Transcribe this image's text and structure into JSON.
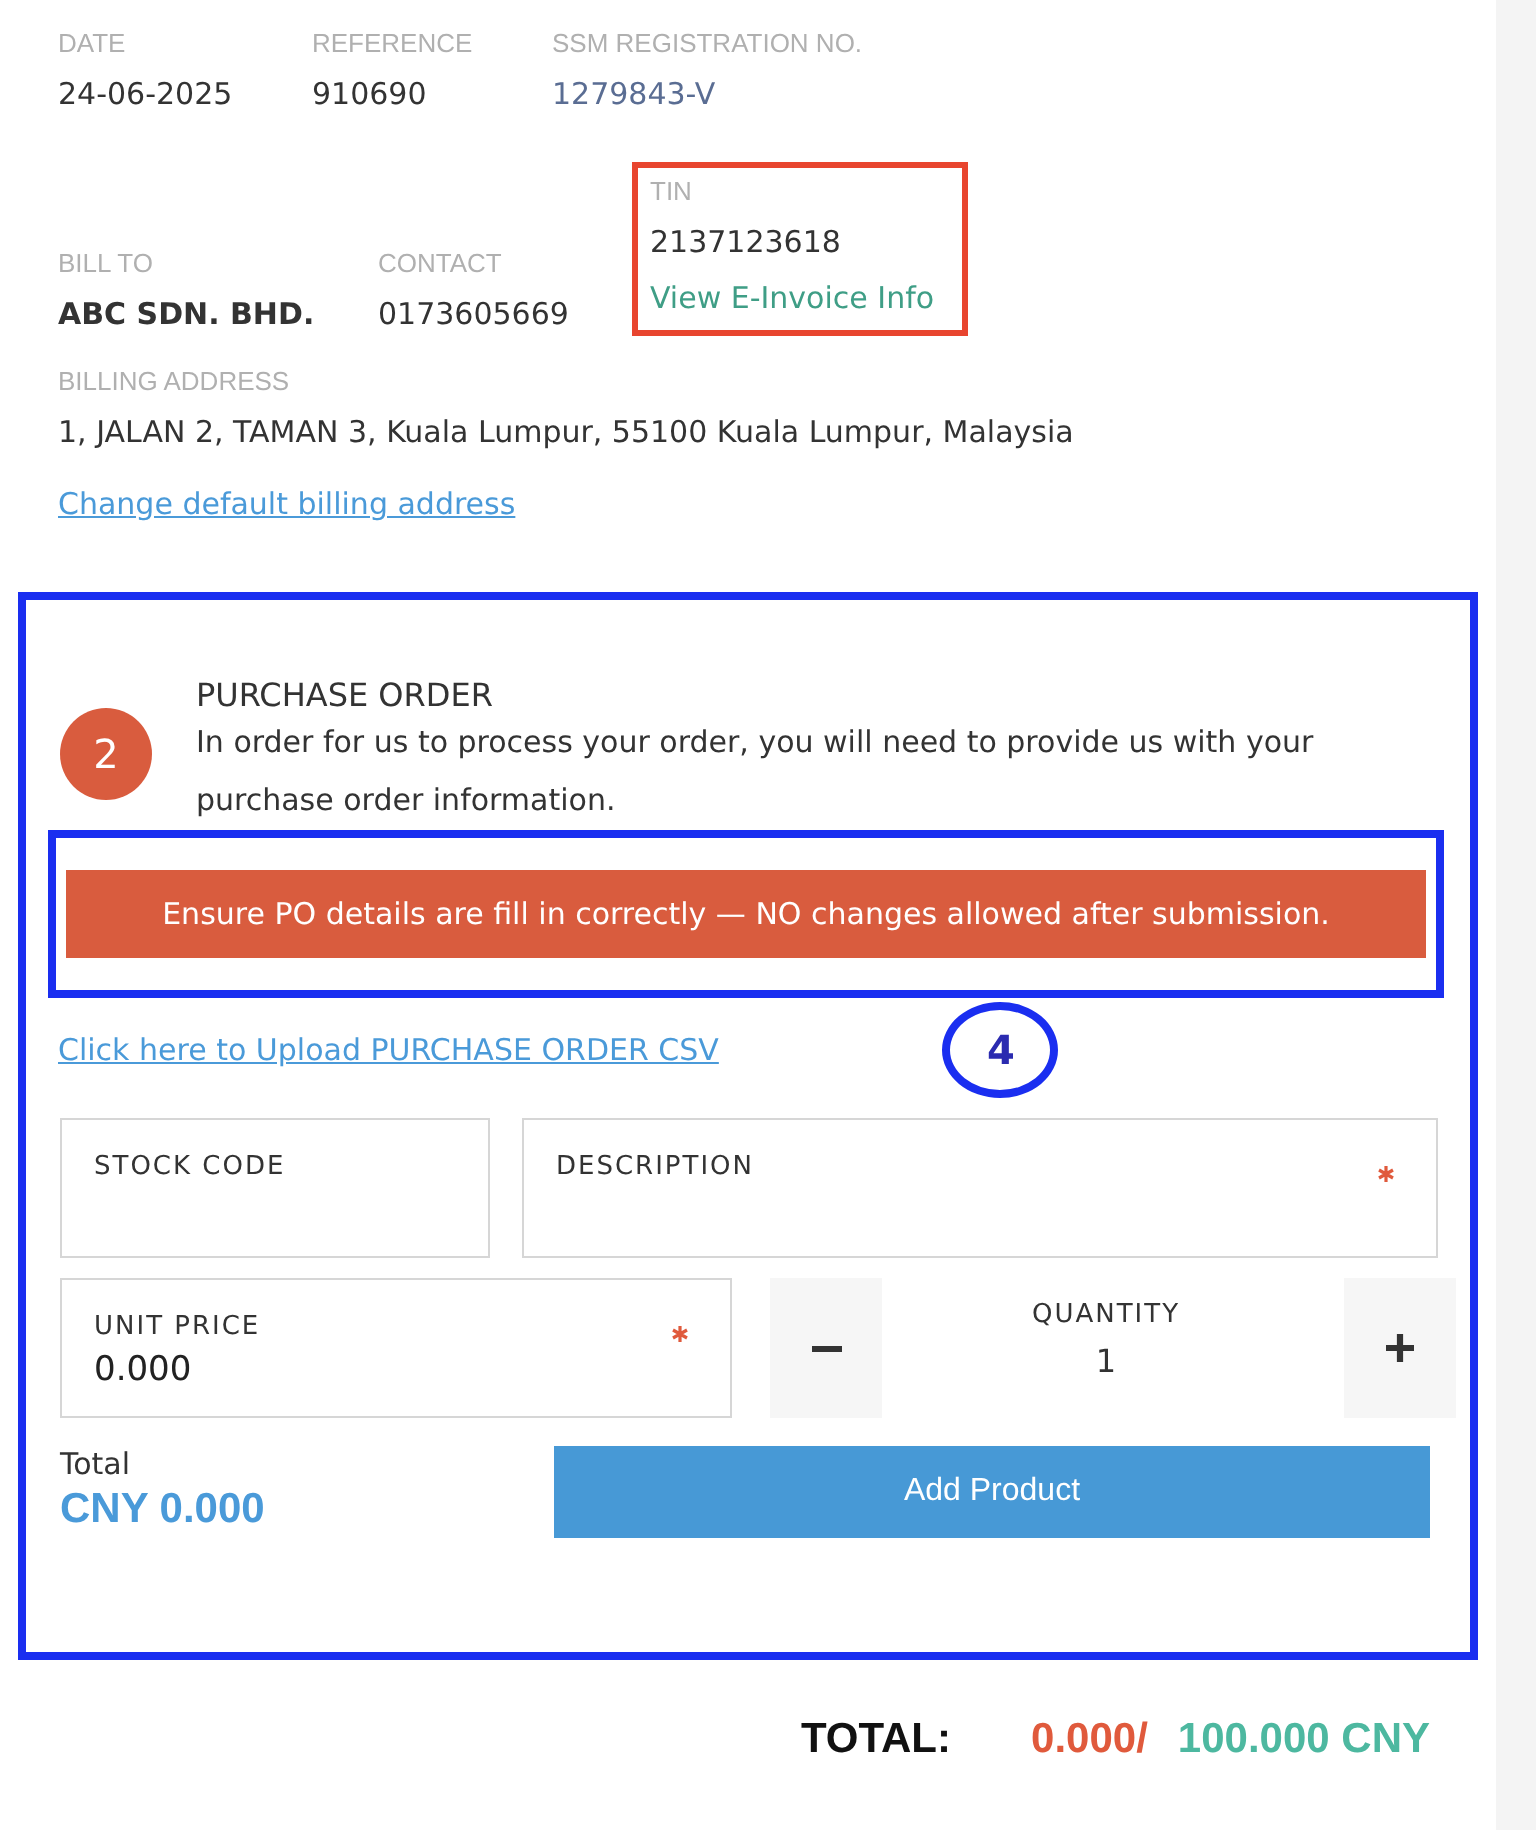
{
  "header_fields": [
    {
      "label": "DATE",
      "value": "24-06-2025",
      "kind": "text"
    },
    {
      "label": "REFERENCE",
      "value": "910690",
      "kind": "text"
    },
    {
      "label": "SSM REGISTRATION NO.",
      "value": "1279843-V",
      "kind": "link"
    }
  ],
  "billing": {
    "bill_to": {
      "label": "BILL TO",
      "value": "ABC SDN. BHD."
    },
    "contact": {
      "label": "CONTACT",
      "value": "0173605669"
    },
    "tin": {
      "label": "TIN",
      "value": "2137123618",
      "link": "View E-Invoice Info",
      "highlighted": true
    },
    "address_label": "BILLING ADDRESS",
    "address": "1, JALAN 2, TAMAN 3, Kuala Lumpur, 55100 Kuala Lumpur, Malaysia",
    "change_link": "Change default billing address"
  },
  "purchase_order": {
    "highlighted": true,
    "step": "2",
    "title": "PURCHASE ORDER",
    "description": "In order for us to process your order, you will need to provide us with your purchase order information.",
    "warning": "Ensure PO details are fill in correctly — NO changes allowed after submission.",
    "warning_highlighted": true,
    "annotation_number": "4",
    "upload_link": "Click here to Upload PURCHASE ORDER CSV",
    "fields": [
      {
        "label": "STOCK CODE",
        "required": false
      },
      {
        "label": "DESCRIPTION",
        "required": true
      }
    ],
    "unit_price": {
      "label": "UNIT PRICE",
      "value": "0.000",
      "required": true
    },
    "quantity": {
      "label": "QUANTITY",
      "value": "1"
    },
    "total_label": "Total",
    "total_value": "CNY 0.000",
    "add_button": "Add Product"
  },
  "summary": {
    "label": "TOTAL:",
    "used": "0.000/",
    "limit": "100.000 CNY"
  }
}
